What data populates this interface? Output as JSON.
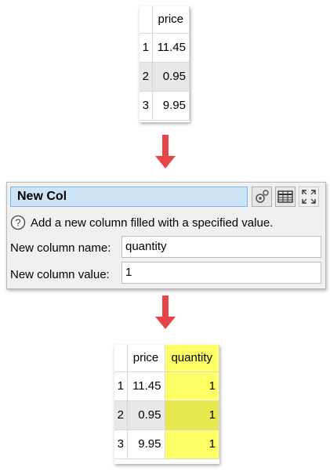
{
  "top_table": {
    "header": "price",
    "rows": [
      {
        "index": "1",
        "price": "11.45"
      },
      {
        "index": "2",
        "price": "0.95"
      },
      {
        "index": "3",
        "price": "9.95"
      }
    ]
  },
  "dialog": {
    "title": "New Col",
    "help_icon": "question-circle-icon",
    "description": "Add a new column filled with a specified value.",
    "name_label": "New column name:",
    "name_value": "quantity",
    "value_label": "New column value:",
    "value_value": "1",
    "buttons": [
      "gear-icon",
      "table-icon",
      "maximize-icon"
    ]
  },
  "bottom_table": {
    "headers": [
      "price",
      "quantity"
    ],
    "rows": [
      {
        "index": "1",
        "price": "11.45",
        "quantity": "1"
      },
      {
        "index": "2",
        "price": "0.95",
        "quantity": "1"
      },
      {
        "index": "3",
        "price": "9.95",
        "quantity": "1"
      }
    ],
    "highlight_color": "#ffff66"
  },
  "arrow_color": "#e8454a"
}
